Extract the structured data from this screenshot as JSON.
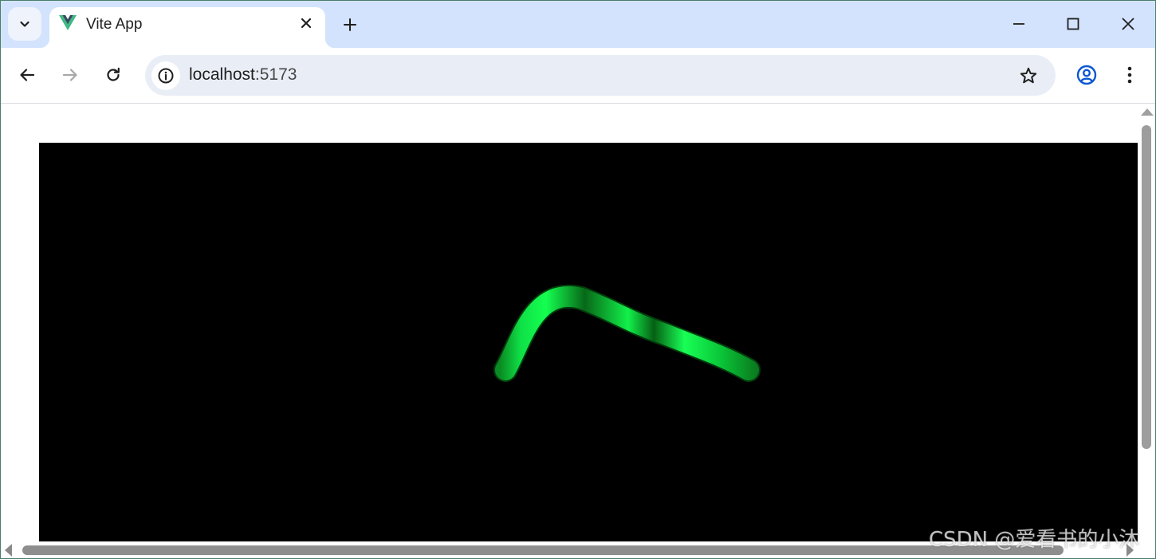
{
  "browser": {
    "tab": {
      "title": "Vite App",
      "favicon": "vue-logo-icon"
    },
    "address_bar": {
      "host": "localhost",
      "port": ":5173"
    },
    "colors": {
      "tabstrip": "#d3e3fd",
      "omnibox": "#e9eef6",
      "accent": "#0b57d0"
    }
  },
  "page": {
    "canvas_background": "#000000",
    "scene": {
      "object": "green tube",
      "colors": [
        "#00ff44",
        "#0a7a1e"
      ]
    },
    "devtools_icons": [
      "vue-devtools-icon",
      "inspect-target-icon"
    ],
    "watermark": "CSDN @爱看书的小沐"
  }
}
